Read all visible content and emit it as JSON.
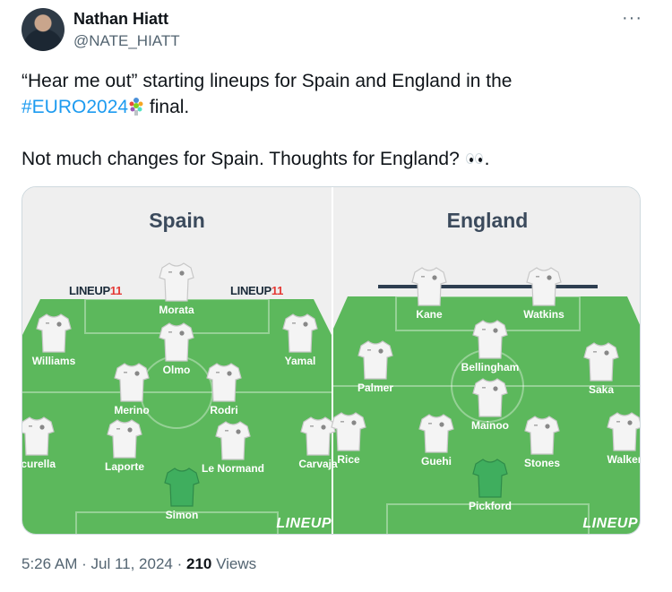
{
  "author": {
    "name": "Nathan Hiatt",
    "handle": "@NATE_HIATT"
  },
  "more_label": "···",
  "tweet": {
    "line1": "“Hear me out” starting lineups for Spain and England in the",
    "hashtag": "#EURO2024",
    "line2_suffix": " final.",
    "line3": "Not much changes for Spain. Thoughts for England? ",
    "line3_end": "."
  },
  "lineups": {
    "logo_text": "LINEUP",
    "logo_num": "11",
    "brand": "LINEUP",
    "spain": {
      "title": "Spain",
      "players": [
        "Morata",
        "Williams",
        "Olmo",
        "Yamal",
        "Merino",
        "Rodri",
        "Cucurella",
        "Laporte",
        "Le Normand",
        "Carvajal",
        "Simon"
      ],
      "visible_names": [
        "Morata",
        "Williams",
        "Olmo",
        "Yamal",
        "Merino",
        "Rodri",
        "ıcurella",
        "Laporte",
        "Le Normand",
        "Carvaja",
        "Simon"
      ]
    },
    "england": {
      "title": "England",
      "visible_names": [
        "Kane",
        "Watkins",
        "Palmer",
        "Bellingham",
        "Saka",
        "Mainoo",
        "Rice",
        "Guehi",
        "Stones",
        "Walker",
        "Pickford"
      ]
    }
  },
  "footer": {
    "time": "5:26 AM",
    "date": "Jul 11, 2024",
    "views_count": "210",
    "views_label": "Views"
  },
  "colors": {
    "pitch": "#5cb85c",
    "goalkeeper_shirt": "#3fae5e",
    "hashtag": "#1d9bf0"
  }
}
